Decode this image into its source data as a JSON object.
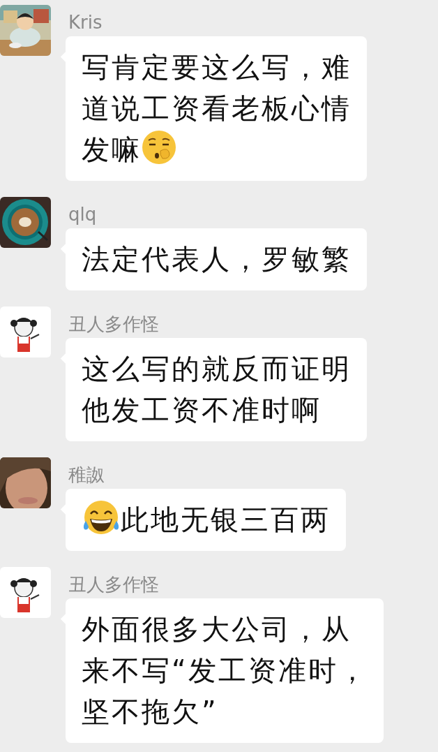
{
  "messages": [
    {
      "sender": "Kris",
      "content": [
        {
          "kind": "text",
          "lines": [
            "写肯定要这么写，难",
            "道说工资看老板心情"
          ]
        },
        {
          "kind": "text",
          "lines": [
            "发嘛"
          ]
        },
        {
          "kind": "kiss"
        }
      ]
    },
    {
      "sender": "qlq",
      "content": [
        {
          "kind": "text",
          "lines": [
            "法定代表人，罗敏繁"
          ]
        }
      ]
    },
    {
      "sender": "丑人多作怪",
      "content": [
        {
          "kind": "text",
          "lines": [
            "这么写的就反而证明",
            "他发工资不准时啊"
          ]
        }
      ]
    },
    {
      "sender": "稚詉",
      "content": [
        {
          "kind": "laugh"
        },
        {
          "kind": "text",
          "lines": [
            "此地无银三百两"
          ]
        }
      ]
    },
    {
      "sender": "丑人多作怪",
      "content": [
        {
          "kind": "text",
          "lines": [
            "外面很多大公司，从",
            "来不写“发工资准时，",
            "坚不拖欠”"
          ]
        }
      ]
    }
  ]
}
